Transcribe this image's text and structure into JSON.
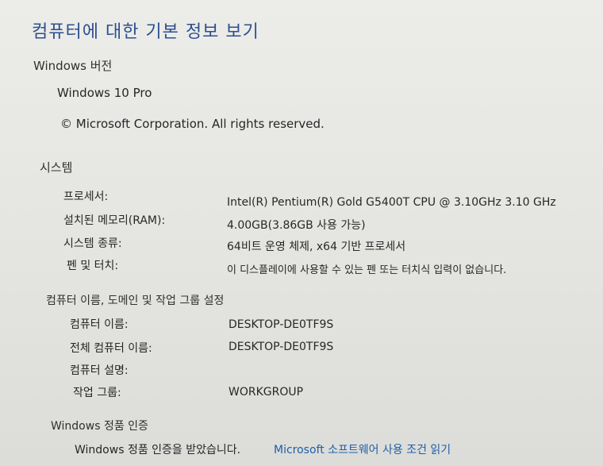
{
  "page": {
    "title": "컴퓨터에 대한 기본 정보 보기"
  },
  "windows_edition": {
    "section_title": "Windows 버전",
    "edition": "Windows 10 Pro",
    "copyright": "© Microsoft Corporation. All rights reserved."
  },
  "system": {
    "section_title": "시스템",
    "rows": [
      {
        "label": "프로세서:",
        "value": "Intel(R) Pentium(R) Gold G5400T CPU @ 3.10GHz   3.10 GHz"
      },
      {
        "label": "설치된 메모리(RAM):",
        "value": "4.00GB(3.86GB 사용 가능)"
      },
      {
        "label": "시스템 종류:",
        "value": "64비트 운영 체제, x64 기반 프로세서"
      },
      {
        "label": "펜 및 터치:",
        "value": "이 디스플레이에 사용할 수 있는 펜 또는 터치식 입력이 없습니다."
      }
    ]
  },
  "computer_name": {
    "section_title": "컴퓨터 이름, 도메인 및 작업 그룹 설정",
    "rows": [
      {
        "label": "컴퓨터 이름:",
        "value": "DESKTOP-DE0TF9S"
      },
      {
        "label": "전체 컴퓨터 이름:",
        "value": "DESKTOP-DE0TF9S"
      },
      {
        "label": "컴퓨터 설명:",
        "value": ""
      },
      {
        "label": "작업 그룹:",
        "value": "WORKGROUP"
      }
    ]
  },
  "activation": {
    "section_title": "Windows 정품 인증",
    "status_text": "Windows 정품 인증을 받았습니다.",
    "license_link": "Microsoft 소프트웨어 사용 조건 읽기"
  }
}
